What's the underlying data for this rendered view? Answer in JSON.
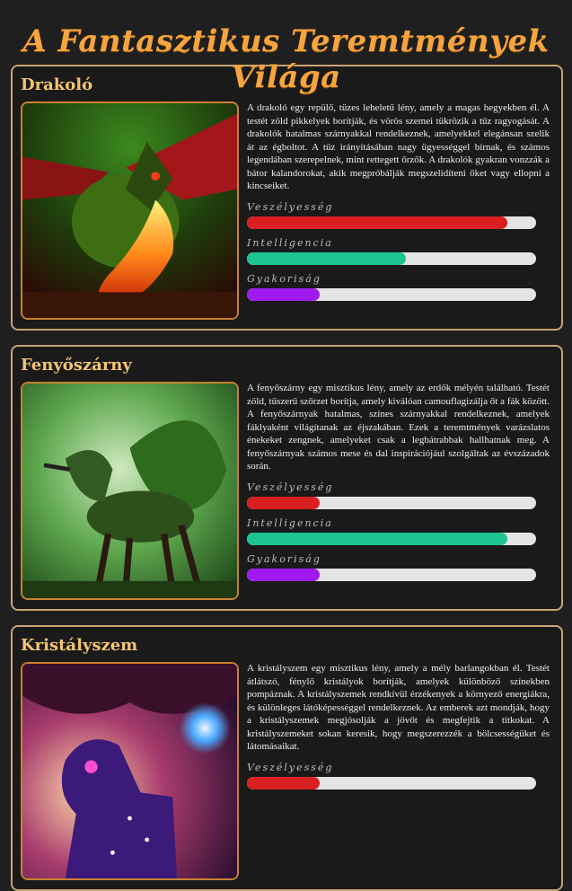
{
  "page": {
    "title": "A Fantasztikus Teremtmények Világa"
  },
  "colors": {
    "danger": "#d91f1f",
    "intelligence": "#1ec392",
    "frequency": "#a01af0",
    "title": "#f6a43c",
    "card_border": "#c7a473"
  },
  "creatures": [
    {
      "name": "Drakoló",
      "image": "dragon-breathing-fire",
      "description": "A drakoló egy repülő, tüzes leheletű lény, amely a magas hegyekben él. A testét zöld pikkelyek borítják, és vörös szemei tükrözik a tűz ragyogását. A drakolók hatalmas szárnyakkal rendelkeznek, amelyekkel elegánsan szelik át az égboltot. A tűz irányításában nagy ügyességgel bírnak, és számos legendában szerepelnek, mint rettegett őrzők. A drakolók gyakran vonzzák a bátor kalandorokat, akik megpróbálják megszelídíteni őket vagy ellopni a kincseiket.",
      "stats": [
        {
          "label": "Veszélyesség",
          "value": 0.9,
          "color": "#d91f1f"
        },
        {
          "label": "Intelligencia",
          "value": 0.55,
          "color": "#1ec392"
        },
        {
          "label": "Gyakoriság",
          "value": 0.25,
          "color": "#a01af0"
        }
      ]
    },
    {
      "name": "Fenyőszárny",
      "image": "green-feathered-forest-beast",
      "description": "A fenyőszárny egy misztikus lény, amely az erdők mélyén található. Testét zöld, tűszerű szőrzet borítja, amely kiválóan camouflagizálja őt a fák között. A fenyőszárnyak hatalmas, színes szárnyakkal rendelkeznek, amelyek fáklyaként világítanak az éjszakában. Ezek a teremtmények varázslatos énekeket zengnek, amelyeket csak a legbátrabbak hallhatnak meg. A fenyőszárnyak számos mese és dal inspirációjául szolgáltak az évszázadok során.",
      "stats": [
        {
          "label": "Veszélyesség",
          "value": 0.25,
          "color": "#d91f1f"
        },
        {
          "label": "Intelligencia",
          "value": 0.9,
          "color": "#1ec392"
        },
        {
          "label": "Gyakoriság",
          "value": 0.25,
          "color": "#a01af0"
        }
      ]
    },
    {
      "name": "Kristályszem",
      "image": "crystal-horse-in-cave",
      "description": "A kristályszem egy misztikus lény, amely a mély barlangokban él. Testét átlátszó, fénylő kristályok borítják, amelyek különböző színekben pompáznak. A kristályszemek rendkívül érzékenyek a környező energiákra, és különleges látóképességgel rendelkeznek. Az emberek azt mondják, hogy a kristályszemek megjósolják a jövőt és megfejtik a titkokat. A kristályszemeket sokan keresik, hogy megszerezzék a bölcsességüket és látomásaikat.",
      "stats": [
        {
          "label": "Veszélyesség",
          "value": 0.25,
          "color": "#d91f1f"
        }
      ]
    }
  ]
}
